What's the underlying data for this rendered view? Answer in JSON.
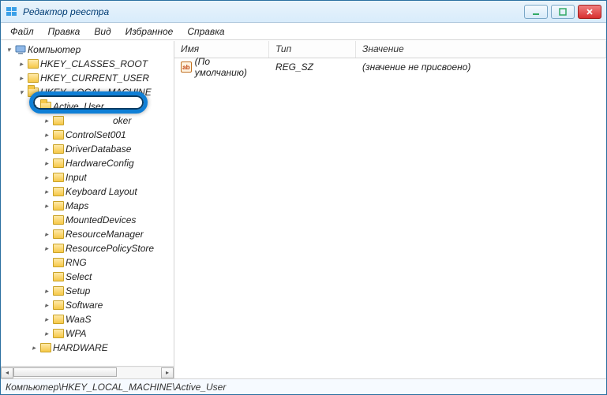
{
  "window": {
    "title": "Редактор реестра"
  },
  "menu": {
    "file": "Файл",
    "edit": "Правка",
    "view": "Вид",
    "favorites": "Избранное",
    "help": "Справка"
  },
  "tree": {
    "root": "Компьютер",
    "hives": {
      "hkcr": "HKEY_CLASSES_ROOT",
      "hkcu": "HKEY_CURRENT_USER",
      "hklm_trunc": "HKEY_LOCAL_MACHINE",
      "hkhw": "HARDWARE"
    },
    "active_user": "Active_User",
    "children": {
      "oker": "oker",
      "controlset001": "ControlSet001",
      "driverdb": "DriverDatabase",
      "hwconfig": "HardwareConfig",
      "input": "Input",
      "kblayout": "Keyboard Layout",
      "maps": "Maps",
      "mounted": "MountedDevices",
      "resmgr": "ResourceManager",
      "respolicy": "ResourcePolicyStore",
      "rng": "RNG",
      "select": "Select",
      "setup": "Setup",
      "software": "Software",
      "waas": "WaaS",
      "wpa": "WPA"
    }
  },
  "list": {
    "headers": {
      "name": "Имя",
      "type": "Тип",
      "data": "Значение"
    },
    "rows": [
      {
        "icon": "ab",
        "name": "(По умолчанию)",
        "type": "REG_SZ",
        "data": "(значение не присвоено)"
      }
    ]
  },
  "status": {
    "path": "Компьютер\\HKEY_LOCAL_MACHINE\\Active_User"
  }
}
